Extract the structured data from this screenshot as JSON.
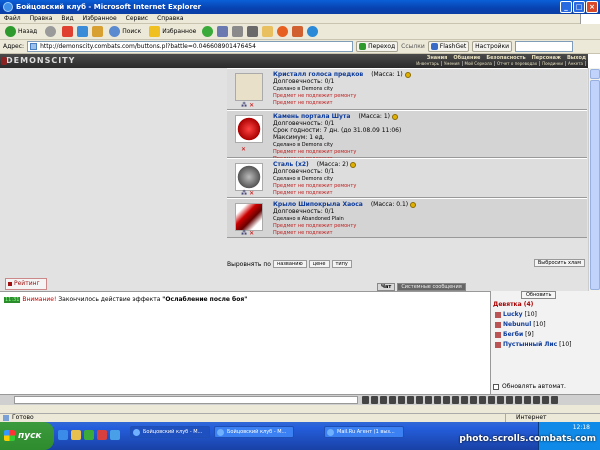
{
  "window": {
    "title": "Бойцовский клуб - Microsoft Internet Explorer"
  },
  "menu": [
    "Файл",
    "Правка",
    "Вид",
    "Избранное",
    "Сервис",
    "Справка"
  ],
  "toolbar": {
    "back": "Назад",
    "search": "Поиск",
    "favorites": "Избранное"
  },
  "address": {
    "label": "Адрес:",
    "url": "http://demonscity.combats.com/buttons.pl?battle=0.046608901476454",
    "go": "Переход",
    "links": "Ссылки",
    "flashget": "FlashGet",
    "settings": "Настройки"
  },
  "game": {
    "logo": "DEMONSCITY",
    "nav": [
      "Знания",
      "Общение",
      "Безопасность",
      "Персонаж",
      "Выход"
    ],
    "nav2": [
      "Инвентарь",
      "Умения",
      "Мой Серкола",
      "Отчет о переводах",
      "Поединки",
      "Анкета"
    ]
  },
  "items": [
    {
      "name": "Кристалл голоса предков",
      "mass": "(Масса: 1)",
      "lines": [
        "Долговечность: 0/1"
      ],
      "small": [
        "Сделано в Demons city"
      ],
      "red": [
        "Предмет не подлежит ремонту",
        "Предмет не подлежит"
      ]
    },
    {
      "name": "Камень портала Шута",
      "mass": "(Масса: 1)",
      "lines": [
        "Долговечность: 0/1",
        "Срок годности: 7 дн. (до 31.08.09 11:06)",
        "Максимум: 1 ед."
      ],
      "small": [
        "Сделано в Demons city"
      ],
      "red": [
        "Предмет не подлежит ремонту",
        "Предмет не подлежит"
      ]
    },
    {
      "name": "Сталь (x2)",
      "mass": "(Масса: 2)",
      "lines": [
        "Долговечность: 0/1"
      ],
      "small": [
        "Сделано в Demons city"
      ],
      "red": [
        "Предмет не подлежит ремонту",
        "Предмет не подлежит"
      ]
    },
    {
      "name": "Крыло Шипокрыла Хаоса",
      "mass": "(Масса: 0.1)",
      "lines": [
        "Долговечность: 0/1"
      ],
      "small": [
        "Сделано в Abandoned Plain"
      ],
      "red": [
        "Предмет не подлежит ремонту",
        "Предмет не подлежит"
      ]
    }
  ],
  "sort": {
    "label": "Выровнять по",
    "by_name": "названию",
    "by_price": "цене",
    "by_type": "типу",
    "discard": "Выбросить хлам"
  },
  "rating": "Рейтинг",
  "chat_tabs": {
    "chat": "Чат",
    "system": "Системные сообщения"
  },
  "chat": {
    "time": "11:31",
    "warning": "Внимание!",
    "text": "Закончилось действие эффекта",
    "effect": "\"Ослабление после боя\""
  },
  "users": {
    "refresh": "Обновить",
    "location": "Девятка (4)",
    "list": [
      {
        "name": "Lucky",
        "level": "[10]"
      },
      {
        "name": "Nebunul",
        "level": "[10]"
      },
      {
        "name": "Бегби",
        "level": "[9]"
      },
      {
        "name": "Пустынный Лис",
        "level": "[10]"
      }
    ],
    "auto": "Обновлять автомат."
  },
  "status": {
    "text": "Готово",
    "zone": "Интернет"
  },
  "taskbar": {
    "start": "пуск",
    "tasks": [
      "Бойцовский клуб - M...",
      "Бойцовский клуб - M...",
      "Mail.Ru Агент (1 выз..."
    ],
    "clock": "12:18",
    "watermark": "photo.scrolls.combats.com"
  },
  "colors": {
    "title_blue": "#0842B0",
    "item_name": "#0B3A9B",
    "warning_red": "#C00000"
  }
}
